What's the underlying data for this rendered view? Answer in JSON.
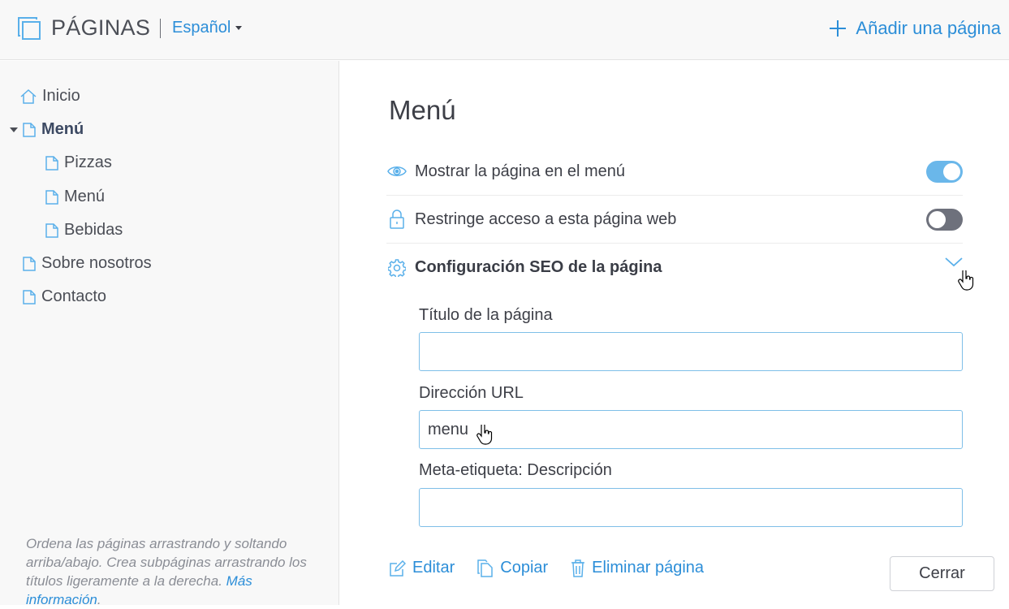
{
  "header": {
    "title": "PÁGINAS",
    "language": "Español",
    "add_page": "Añadir una página"
  },
  "sidebar": {
    "items": [
      {
        "label": "Inicio",
        "icon": "home-icon"
      },
      {
        "label": "Menú",
        "icon": "page-icon",
        "active": true,
        "expanded": true
      },
      {
        "label": "Pizzas",
        "icon": "page-icon"
      },
      {
        "label": "Menú",
        "icon": "page-icon"
      },
      {
        "label": "Bebidas",
        "icon": "page-icon"
      },
      {
        "label": "Sobre nosotros",
        "icon": "page-icon"
      },
      {
        "label": "Contacto",
        "icon": "page-icon"
      }
    ],
    "help_text": "Ordena las páginas arrastrando y soltando arriba/abajo. Crea subpáginas arrastrando los títulos ligeramente a la derecha.",
    "help_link": "Más información"
  },
  "main": {
    "title": "Menú",
    "options": {
      "show_in_menu": {
        "label": "Mostrar la página en el menú",
        "enabled": true
      },
      "restrict_access": {
        "label": "Restringe acceso a esta página web",
        "enabled": false
      },
      "seo": {
        "label": "Configuración SEO de la página",
        "expanded": true
      }
    },
    "fields": {
      "page_title": {
        "label": "Título de la página",
        "value": ""
      },
      "url": {
        "label": "Dirección URL",
        "value": "menu"
      },
      "meta_description": {
        "label": "Meta-etiqueta: Descripción",
        "value": ""
      }
    },
    "actions": {
      "edit": "Editar",
      "copy": "Copiar",
      "delete": "Eliminar página",
      "close": "Cerrar"
    }
  },
  "colors": {
    "accent": "#2c8ed8",
    "toggle_on": "#6ab7ea",
    "toggle_off": "#6e717c",
    "input_border": "#7fbfe8"
  }
}
